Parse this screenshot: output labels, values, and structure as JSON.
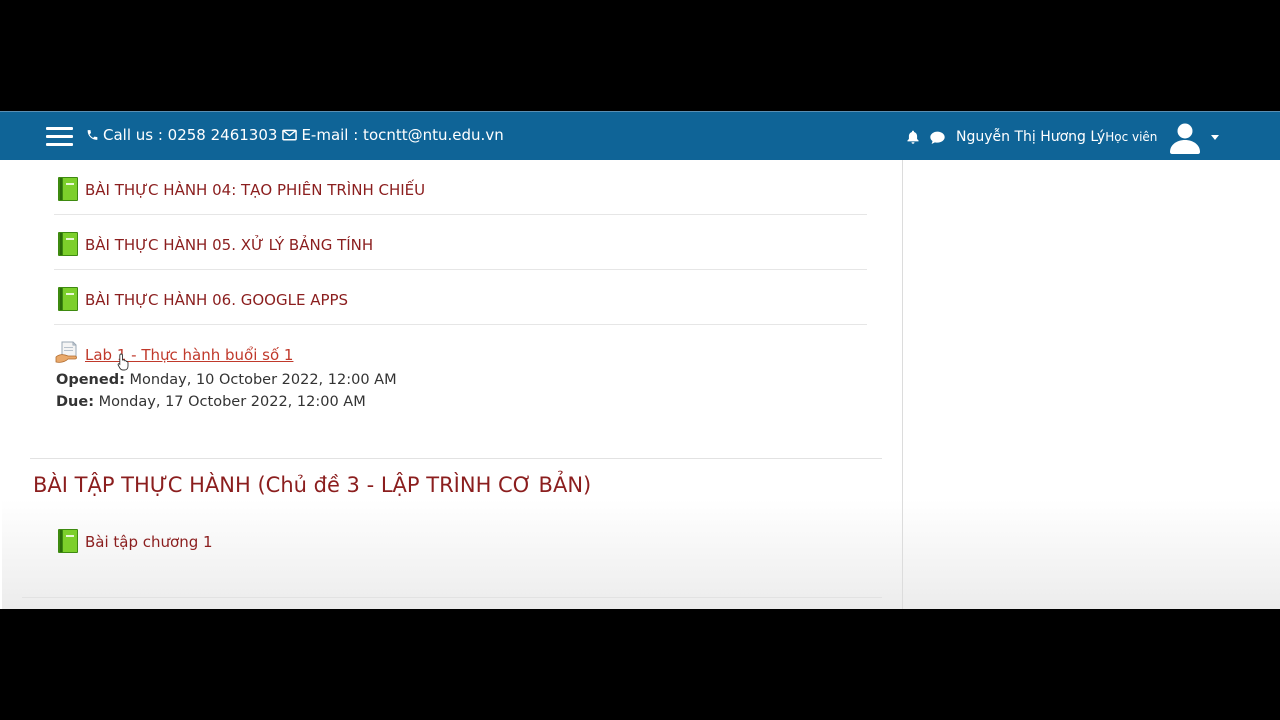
{
  "navbar": {
    "phone_label": "Call us : 0258 2461303",
    "email_label": "E-mail : tocntt@ntu.edu.vn",
    "user_name": "Nguyễn Thị Hương Lý",
    "user_role": "Học viên"
  },
  "activities": [
    {
      "title": "BÀI THỰC HÀNH 04: TẠO PHIÊN TRÌNH CHIẾU"
    },
    {
      "title": "BÀI THỰC HÀNH 05. XỬ LÝ BẢNG TÍNH"
    },
    {
      "title": "BÀI THỰC HÀNH 06. GOOGLE APPS"
    }
  ],
  "assignment": {
    "title": "Lab 1 - Thực hành buổi số 1",
    "opened_label": "Opened:",
    "opened_value": "Monday, 10 October 2022, 12:00 AM",
    "due_label": "Due:",
    "due_value": "Monday, 17 October 2022, 12:00 AM"
  },
  "section": {
    "title": "BÀI TẬP THỰC HÀNH (Chủ đề 3 - LẬP TRÌNH CƠ BẢN)",
    "activities": [
      {
        "title": "Bài tập chương 1"
      }
    ]
  },
  "colors": {
    "navbar": "#0f6497",
    "link": "#8b1e1e",
    "assignment_link": "#c0392b",
    "book_icon": "#6cbf2a"
  },
  "icons": [
    "menu-icon",
    "phone-icon",
    "envelope-icon",
    "bell-icon",
    "chat-icon",
    "avatar-icon",
    "caret-down-icon",
    "book-icon",
    "assignment-icon",
    "mouse-cursor-icon"
  ]
}
